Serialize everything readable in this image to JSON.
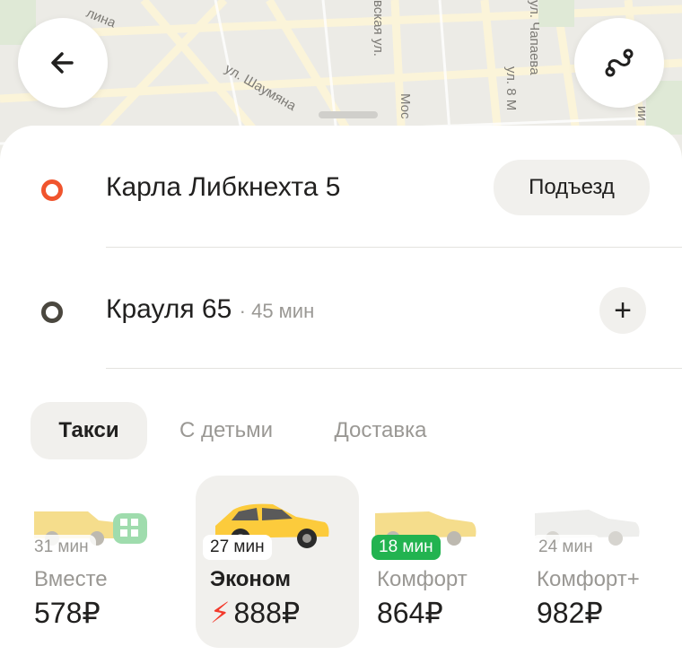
{
  "map": {
    "streets": {
      "linina": "лина",
      "shaumyana": "ул. Шаумяна",
      "moskovskaya": "вская ул.",
      "mos": "Мос",
      "chapaeva": "ул. Чапаева",
      "ul8": "ул. 8 М",
      "edge": "ии"
    }
  },
  "header": {
    "back_icon": "arrow-left-icon",
    "route_icon": "route-icon"
  },
  "route": {
    "from": {
      "address": "Карла Либкнехта 5",
      "entrance_label": "Подъезд",
      "dot_color": "#f0542d"
    },
    "to": {
      "address": "Крауля 65",
      "eta": "· 45 мин",
      "dot_color": "#4a473f",
      "add_label": "+"
    }
  },
  "tabs": [
    {
      "label": "Такси",
      "active": true
    },
    {
      "label": "С детьми",
      "active": false
    },
    {
      "label": "Доставка",
      "active": false
    }
  ],
  "tariffs": [
    {
      "name": "Вместе",
      "time": "31 мин",
      "price": "578₽",
      "selected": false,
      "badge": "dim"
    },
    {
      "name": "Эконом",
      "time": "27 мин",
      "price": "888₽",
      "selected": true,
      "surge_icon": "⚡",
      "badge": "white"
    },
    {
      "name": "Комфорт",
      "time": "18 мин",
      "price": "864₽",
      "selected": false,
      "badge": "green"
    },
    {
      "name": "Комфорт+",
      "time": "24 мин",
      "price": "982₽",
      "selected": false,
      "badge": "dim"
    }
  ],
  "colors": {
    "accent_yellow": "#fccb3c",
    "surge_red": "#f33a2c",
    "fast_green": "#22b350"
  }
}
